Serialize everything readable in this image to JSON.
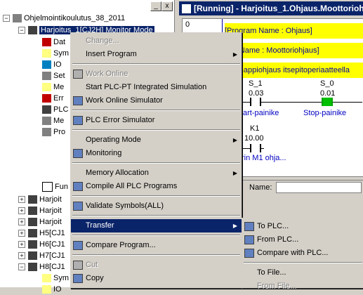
{
  "tree": {
    "root_label": "Ohjelmointikoulutus_38_2011",
    "selected_label": "Harjoitus_1[CJ2H] Monitor Mode",
    "children": [
      "Dat",
      "Sym",
      "IO",
      "Set",
      "Me",
      "Err",
      "PLC",
      "Me",
      "Pro"
    ],
    "func_label": "Fun",
    "siblings": [
      "Harjoit",
      "Harjoit",
      "Harjoit",
      "H5[CJ1",
      "H6[CJ1",
      "H7[CJ1",
      "H8[CJ1"
    ],
    "sub_items": [
      "Sym",
      "IO"
    ],
    "close_glyph": "x",
    "min_glyph": "_"
  },
  "ladder": {
    "title": "[Running] - Harjoitus_1.Ohjaus.Moottoriohjaus",
    "rung_number": "0",
    "program_name": "[Program Name : Ohjaus]",
    "section_name": "tion Name : Moottoriohjaus]",
    "comment": "ainonappiohjaus itsepitoperiaatteella",
    "contacts": [
      {
        "addr": "S_1",
        "value": "0.03",
        "label": "art-painike"
      },
      {
        "addr": "S_0",
        "value": "0.01",
        "label": "Stop-painike"
      },
      {
        "addr": "K1",
        "value": "10.00",
        "label": "rin M1 ohja..."
      }
    ],
    "name_label": "Name:"
  },
  "menu": {
    "items": [
      {
        "label": "Change...",
        "disabled": true
      },
      {
        "label": "Insert Program",
        "submenu": true
      },
      {
        "sep": true
      },
      {
        "label": "Work Online",
        "disabled": true,
        "icon": "plug-icon"
      },
      {
        "label": "Start PLC-PT Integrated Simulation"
      },
      {
        "label": "Work Online Simulator",
        "icon": "simulator-icon"
      },
      {
        "sep": true
      },
      {
        "label": "PLC Error Simulator",
        "icon": "error-simulator-icon"
      },
      {
        "sep": true
      },
      {
        "label": "Operating Mode",
        "submenu": true
      },
      {
        "label": "Monitoring",
        "icon": "monitoring-icon"
      },
      {
        "sep": true
      },
      {
        "label": "Memory Allocation",
        "submenu": true
      },
      {
        "label": "Compile All PLC Programs",
        "icon": "compile-icon"
      },
      {
        "sep": true
      },
      {
        "label": "Validate Symbols(ALL)",
        "icon": "validate-icon"
      },
      {
        "sep": true
      },
      {
        "label": "Transfer",
        "submenu": true,
        "selected": true
      },
      {
        "sep": true
      },
      {
        "label": "Compare Program...",
        "icon": "compare-icon"
      },
      {
        "sep": true
      },
      {
        "label": "Cut",
        "disabled": true,
        "icon": "scissors-icon"
      },
      {
        "label": "Copy",
        "icon": "copy-icon"
      }
    ]
  },
  "submenu": {
    "items": [
      {
        "label": "To PLC...",
        "icon": "to-plc-icon"
      },
      {
        "label": "From PLC...",
        "icon": "from-plc-icon"
      },
      {
        "label": "Compare with PLC...",
        "icon": "compare-plc-icon"
      },
      {
        "sep": true
      },
      {
        "label": "To File..."
      },
      {
        "label": "From File...",
        "disabled": true
      }
    ]
  },
  "colors": {
    "selection": "#0a246a",
    "menu_bg": "#d4d0c8",
    "yellow": "#ffff00"
  }
}
